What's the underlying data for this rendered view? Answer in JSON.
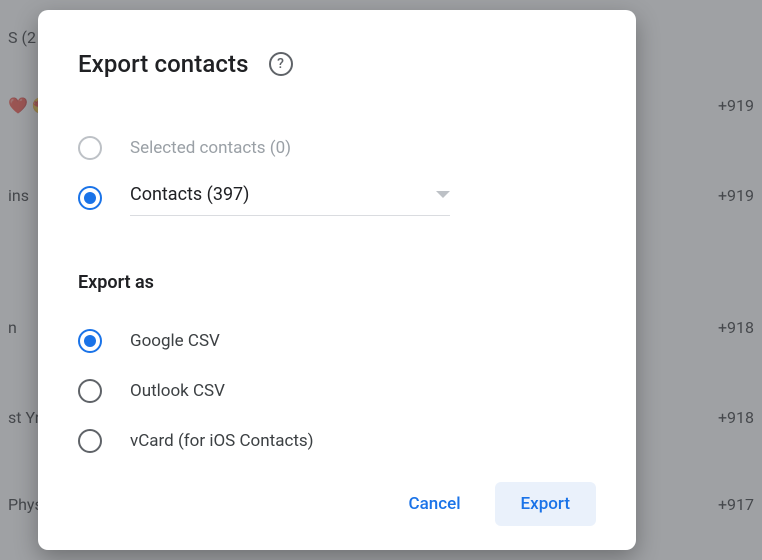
{
  "background": {
    "rows": [
      {
        "left": "S (2",
        "right": ""
      },
      {
        "left": "❤️ 😍",
        "right": "+919"
      },
      {
        "left": "ins",
        "right": "+919"
      },
      {
        "left": "n",
        "right": "+918"
      },
      {
        "left": "st Yr",
        "right": "+918"
      },
      {
        "left": "Phys",
        "right": "+917"
      }
    ]
  },
  "dialog": {
    "title": "Export contacts",
    "source": {
      "selected_label": "Selected contacts (0)",
      "contacts_label": "Contacts (397)"
    },
    "export_as_heading": "Export as",
    "formats": {
      "google_csv": "Google CSV",
      "outlook_csv": "Outlook CSV",
      "vcard": "vCard (for iOS Contacts)"
    },
    "actions": {
      "cancel": "Cancel",
      "export": "Export"
    }
  }
}
